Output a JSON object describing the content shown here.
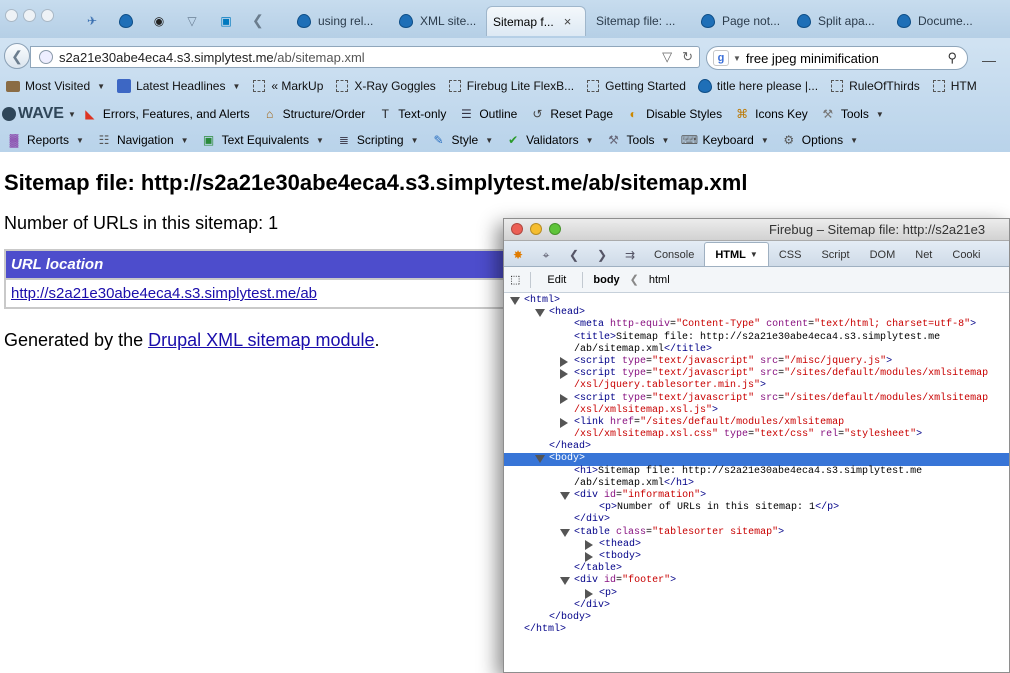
{
  "browser": {
    "tabs": [
      {
        "label": "",
        "icon": "wave-bird-icon"
      },
      {
        "label": "",
        "icon": "drupal-icon"
      },
      {
        "label": "",
        "icon": "owl-icon"
      },
      {
        "label": "",
        "icon": "fox-icon"
      },
      {
        "label": "",
        "icon": "trello-icon"
      },
      {
        "label": "using rel...",
        "icon": "drupal-icon"
      },
      {
        "label": "XML site...",
        "icon": "drupal-icon"
      },
      {
        "label": "Sitemap f...",
        "icon": "none",
        "active": true
      },
      {
        "label": "Sitemap file: ...",
        "icon": "none"
      },
      {
        "label": "Page not...",
        "icon": "drupal-icon"
      },
      {
        "label": "Split apa...",
        "icon": "drupal-icon"
      },
      {
        "label": "Docume...",
        "icon": "drupal-icon"
      }
    ],
    "url": {
      "host": "s2a21e30abe4eca4.s3.simplytest.me",
      "path": "/ab/sitemap.xml"
    },
    "search": {
      "engine": "g",
      "query": "free jpeg minimification"
    }
  },
  "bookmarks": [
    {
      "label": "Most Visited",
      "icon": "folder-icon",
      "dropdown": true
    },
    {
      "label": "Latest Headlines",
      "icon": "rss-icon",
      "dropdown": true
    },
    {
      "label": "« MarkUp",
      "icon": "bookmark-icon"
    },
    {
      "label": "X-Ray Goggles",
      "icon": "bookmark-icon"
    },
    {
      "label": "Firebug Lite FlexB...",
      "icon": "bookmark-icon"
    },
    {
      "label": "Getting Started",
      "icon": "bookmark-icon"
    },
    {
      "label": "title here please |...",
      "icon": "drupal-icon"
    },
    {
      "label": "RuleOfThirds",
      "icon": "bookmark-icon"
    },
    {
      "label": "HTM",
      "icon": "bookmark-icon"
    }
  ],
  "wave": {
    "logo": "WAVE",
    "tools": [
      {
        "label": "Errors, Features, and Alerts",
        "icon": "errors-icon"
      },
      {
        "label": "Structure/Order",
        "icon": "structure-icon"
      },
      {
        "label": "Text-only",
        "icon": "text-only-icon"
      },
      {
        "label": "Outline",
        "icon": "outline-icon"
      },
      {
        "label": "Reset Page",
        "icon": "reset-icon"
      },
      {
        "label": "Disable Styles",
        "icon": "disable-styles-icon"
      },
      {
        "label": "Icons Key",
        "icon": "icons-key-icon"
      },
      {
        "label": "Tools",
        "icon": "tools-icon"
      }
    ]
  },
  "webdev": [
    {
      "label": "Reports",
      "icon": "reports-icon"
    },
    {
      "label": "Navigation",
      "icon": "navigation-icon"
    },
    {
      "label": "Text Equivalents",
      "icon": "image-icon"
    },
    {
      "label": "Scripting",
      "icon": "scripting-icon"
    },
    {
      "label": "Style",
      "icon": "style-icon"
    },
    {
      "label": "Validators",
      "icon": "check-icon"
    },
    {
      "label": "Tools",
      "icon": "wrench-icon"
    },
    {
      "label": "Keyboard",
      "icon": "keyboard-icon"
    },
    {
      "label": "Options",
      "icon": "options-icon"
    }
  ],
  "page": {
    "title": "Sitemap file: http://s2a21e30abe4eca4.s3.simplytest.me/ab/sitemap.xml",
    "count": "Number of URLs in this sitemap: 1",
    "table_header": "URL location",
    "rows": [
      "http://s2a21e30abe4eca4.s3.simplytest.me/ab"
    ],
    "footer_prefix": "Generated by the ",
    "footer_link": "Drupal XML sitemap module",
    "footer_suffix": "."
  },
  "firebug": {
    "title": "Firebug – Sitemap file: http://s2a21e3",
    "tabs": [
      "Console",
      "HTML",
      "CSS",
      "Script",
      "DOM",
      "Net",
      "Cooki"
    ],
    "active_tab": "HTML",
    "crumbs": {
      "edit": "Edit",
      "path": [
        "body",
        "html"
      ]
    },
    "tree": [
      {
        "indent": 0,
        "tw": "open",
        "html": "<span class=\"tag\">&lt;html&gt;</span>"
      },
      {
        "indent": 1,
        "tw": "open",
        "html": "<span class=\"tag\">&lt;head&gt;</span>"
      },
      {
        "indent": 2,
        "tw": "",
        "html": "<span class=\"tag\">&lt;meta</span> <span class=\"attr\">http-equiv</span>=<span class=\"val\">\"Content-Type\"</span> <span class=\"attr\">content</span>=<span class=\"val\">\"text/html; charset=utf-8\"</span><span class=\"tag\">&gt;</span>"
      },
      {
        "indent": 2,
        "tw": "",
        "html": "<span class=\"tag\">&lt;title&gt;</span>Sitemap file: http://s2a21e30abe4eca4.s3.simplytest.me"
      },
      {
        "indent": 2,
        "tw": "",
        "html": "/ab/sitemap.xml<span class=\"tag\">&lt;/title&gt;</span>"
      },
      {
        "indent": 2,
        "tw": "closed",
        "html": "<span class=\"tag\">&lt;script</span> <span class=\"attr\">type</span>=<span class=\"val\">\"text/javascript\"</span> <span class=\"attr\">src</span>=<span class=\"val\">\"/misc/jquery.js\"</span><span class=\"tag\">&gt;</span>"
      },
      {
        "indent": 2,
        "tw": "closed",
        "html": "<span class=\"tag\">&lt;script</span> <span class=\"attr\">type</span>=<span class=\"val\">\"text/javascript\"</span> <span class=\"attr\">src</span>=<span class=\"val\">\"/sites/default/modules/xmlsitemap</span>"
      },
      {
        "indent": 2,
        "tw": "",
        "html": "<span class=\"val\">/xsl/jquery.tablesorter.min.js\"</span><span class=\"tag\">&gt;</span>"
      },
      {
        "indent": 2,
        "tw": "closed",
        "html": "<span class=\"tag\">&lt;script</span> <span class=\"attr\">type</span>=<span class=\"val\">\"text/javascript\"</span> <span class=\"attr\">src</span>=<span class=\"val\">\"/sites/default/modules/xmlsitemap</span>"
      },
      {
        "indent": 2,
        "tw": "",
        "html": "<span class=\"val\">/xsl/xmlsitemap.xsl.js\"</span><span class=\"tag\">&gt;</span>"
      },
      {
        "indent": 2,
        "tw": "closed",
        "html": "<span class=\"tag\">&lt;link</span> <span class=\"attr\">href</span>=<span class=\"val\">\"/sites/default/modules/xmlsitemap</span>"
      },
      {
        "indent": 2,
        "tw": "",
        "html": "<span class=\"val\">/xsl/xmlsitemap.xsl.css\"</span> <span class=\"attr\">type</span>=<span class=\"val\">\"text/css\"</span> <span class=\"attr\">rel</span>=<span class=\"val\">\"stylesheet\"</span><span class=\"tag\">&gt;</span>"
      },
      {
        "indent": 1,
        "tw": "",
        "html": "<span class=\"tag\">&lt;/head&gt;</span>"
      },
      {
        "indent": 1,
        "tw": "open",
        "sel": true,
        "html": "<span class=\"tag\">&lt;body&gt;</span>"
      },
      {
        "indent": 2,
        "tw": "",
        "html": "<span class=\"tag\">&lt;h1&gt;</span>Sitemap file: http://s2a21e30abe4eca4.s3.simplytest.me"
      },
      {
        "indent": 2,
        "tw": "",
        "html": "/ab/sitemap.xml<span class=\"tag\">&lt;/h1&gt;</span>"
      },
      {
        "indent": 2,
        "tw": "open",
        "html": "<span class=\"tag\">&lt;div</span> <span class=\"attr\">id</span>=<span class=\"val\">\"information\"</span><span class=\"tag\">&gt;</span>"
      },
      {
        "indent": 3,
        "tw": "",
        "html": "<span class=\"tag\">&lt;p&gt;</span>Number of URLs in this sitemap: 1<span class=\"tag\">&lt;/p&gt;</span>"
      },
      {
        "indent": 2,
        "tw": "",
        "html": "<span class=\"tag\">&lt;/div&gt;</span>"
      },
      {
        "indent": 2,
        "tw": "open",
        "html": "<span class=\"tag\">&lt;table</span> <span class=\"attr\">class</span>=<span class=\"val\">\"tablesorter sitemap\"</span><span class=\"tag\">&gt;</span>"
      },
      {
        "indent": 3,
        "tw": "closed",
        "html": "<span class=\"tag\">&lt;thead&gt;</span>"
      },
      {
        "indent": 3,
        "tw": "closed",
        "html": "<span class=\"tag\">&lt;tbody&gt;</span>"
      },
      {
        "indent": 2,
        "tw": "",
        "html": "<span class=\"tag\">&lt;/table&gt;</span>"
      },
      {
        "indent": 2,
        "tw": "open",
        "html": "<span class=\"tag\">&lt;div</span> <span class=\"attr\">id</span>=<span class=\"val\">\"footer\"</span><span class=\"tag\">&gt;</span>"
      },
      {
        "indent": 3,
        "tw": "closed",
        "html": "<span class=\"tag\">&lt;p&gt;</span>"
      },
      {
        "indent": 2,
        "tw": "",
        "html": "<span class=\"tag\">&lt;/div&gt;</span>"
      },
      {
        "indent": 1,
        "tw": "",
        "html": "<span class=\"tag\">&lt;/body&gt;</span>"
      },
      {
        "indent": 0,
        "tw": "",
        "html": "<span class=\"tag\">&lt;/html&gt;</span>"
      }
    ]
  },
  "colors": {
    "table_header_bg": "#4d4dcc",
    "link": "#1a0dab",
    "selection": "#3875d7"
  }
}
